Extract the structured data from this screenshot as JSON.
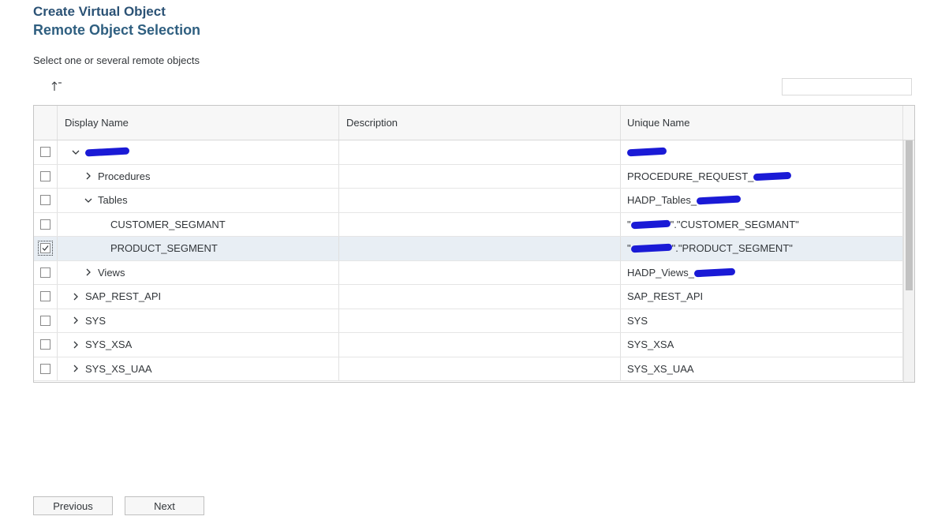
{
  "header": {
    "title": "Create Virtual Object",
    "subtitle": "Remote Object Selection"
  },
  "instruction": "Select one or several remote objects",
  "toolbar": {
    "sort_icon": "sort-ascending-icon",
    "search_placeholder": ""
  },
  "table": {
    "columns": [
      "Display Name",
      "Description",
      "Unique Name"
    ],
    "rows": [
      {
        "level": 0,
        "expander": "expanded",
        "display_name": "",
        "display_redacted": true,
        "description": "",
        "unique_name": "",
        "unique_redacted": true,
        "checked": false
      },
      {
        "level": 1,
        "expander": "collapsed",
        "display_name": "Procedures",
        "description": "",
        "unique_name": "PROCEDURE_REQUEST_",
        "unique_redacted": true,
        "checked": false
      },
      {
        "level": 1,
        "expander": "expanded",
        "display_name": "Tables",
        "description": "",
        "unique_name": "HADP_Tables_",
        "unique_redacted": true,
        "checked": false
      },
      {
        "level": 2,
        "expander": "none",
        "display_name": "CUSTOMER_SEGMANT",
        "description": "",
        "unique_prefix": "\"",
        "unique_name": "\".\"CUSTOMER_SEGMANT\"",
        "unique_redacted": true,
        "checked": false
      },
      {
        "level": 2,
        "expander": "none",
        "display_name": "PRODUCT_SEGMENT",
        "description": "",
        "unique_prefix": "\"",
        "unique_name": "\".\"PRODUCT_SEGMENT\"",
        "unique_redacted": true,
        "checked": true,
        "selected": true
      },
      {
        "level": 1,
        "expander": "collapsed",
        "display_name": "Views",
        "description": "",
        "unique_name": "HADP_Views_",
        "unique_redacted": true,
        "checked": false
      },
      {
        "level": 0,
        "expander": "collapsed",
        "display_name": "SAP_REST_API",
        "description": "",
        "unique_name": "SAP_REST_API",
        "unique_redacted": false,
        "checked": false
      },
      {
        "level": 0,
        "expander": "collapsed",
        "display_name": "SYS",
        "description": "",
        "unique_name": "SYS",
        "unique_redacted": false,
        "checked": false
      },
      {
        "level": 0,
        "expander": "collapsed",
        "display_name": "SYS_XSA",
        "description": "",
        "unique_name": "SYS_XSA",
        "unique_redacted": false,
        "checked": false
      },
      {
        "level": 0,
        "expander": "collapsed",
        "display_name": "SYS_XS_UAA",
        "description": "",
        "unique_name": "SYS_XS_UAA",
        "unique_redacted": false,
        "checked": false
      }
    ]
  },
  "footer": {
    "previous_label": "Previous",
    "next_label": "Next"
  },
  "colors": {
    "title": "#2b5275",
    "redaction": "#1a1ad6",
    "selected_row": "#e8eef4"
  }
}
